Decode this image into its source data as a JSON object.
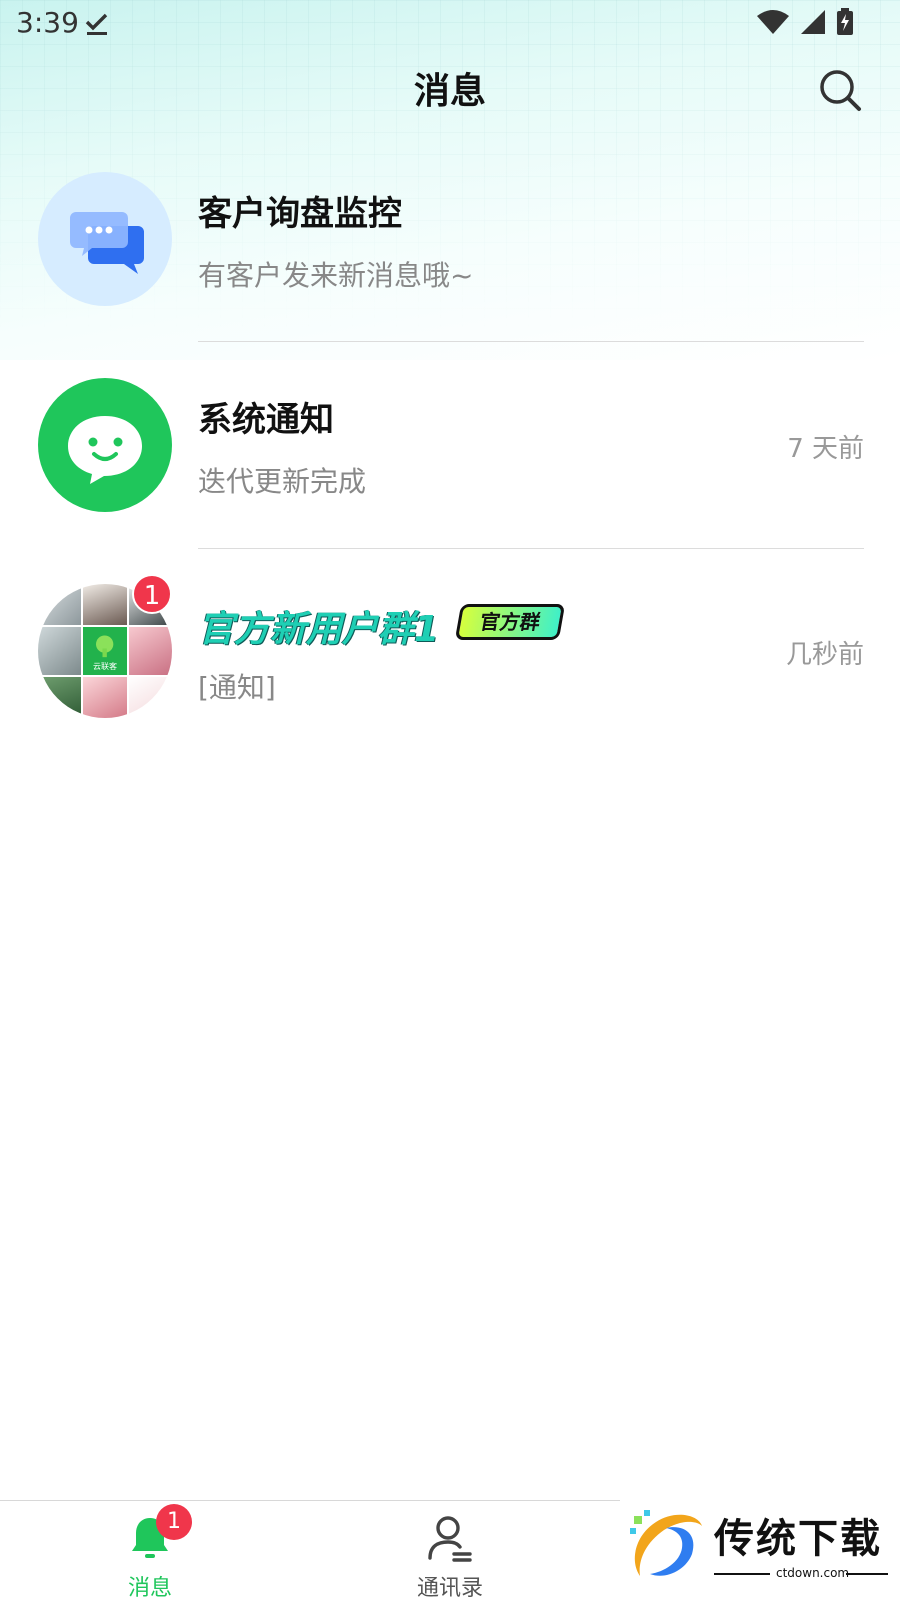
{
  "status_bar": {
    "time": "3:39",
    "icons": [
      "download-done-icon",
      "wifi-icon",
      "signal-icon",
      "battery-charging-icon"
    ]
  },
  "header": {
    "title": "消息",
    "search_icon": "search-icon"
  },
  "conversations": [
    {
      "title": "客户询盘监控",
      "subtitle": "有客户发来新消息哦~",
      "time": "",
      "avatar_icon": "chat-bubbles-icon",
      "avatar_bg": "#d6ecff"
    },
    {
      "title": "系统通知",
      "subtitle": "迭代更新完成",
      "time": "7 天前",
      "avatar_icon": "smiley-chat-icon",
      "avatar_bg": "#1fc65b"
    },
    {
      "title": "官方新用户群1",
      "tag": "官方群",
      "subtitle": "[通知]",
      "time": "几秒前",
      "unread": "1",
      "avatar_icon": "group-mosaic-avatar",
      "mosaic_caption": "云联客"
    }
  ],
  "bottom_nav": {
    "items": [
      {
        "label": "消息",
        "icon": "bell-icon",
        "active": true,
        "badge": "1"
      },
      {
        "label": "通讯录",
        "icon": "contacts-icon",
        "active": false
      }
    ]
  },
  "watermark": {
    "text": "传统下载",
    "url": "ctdown.com"
  },
  "colors": {
    "accent_green": "#1fc65b",
    "badge_red": "#f0364b",
    "teal_title": "#1fcfb4"
  }
}
